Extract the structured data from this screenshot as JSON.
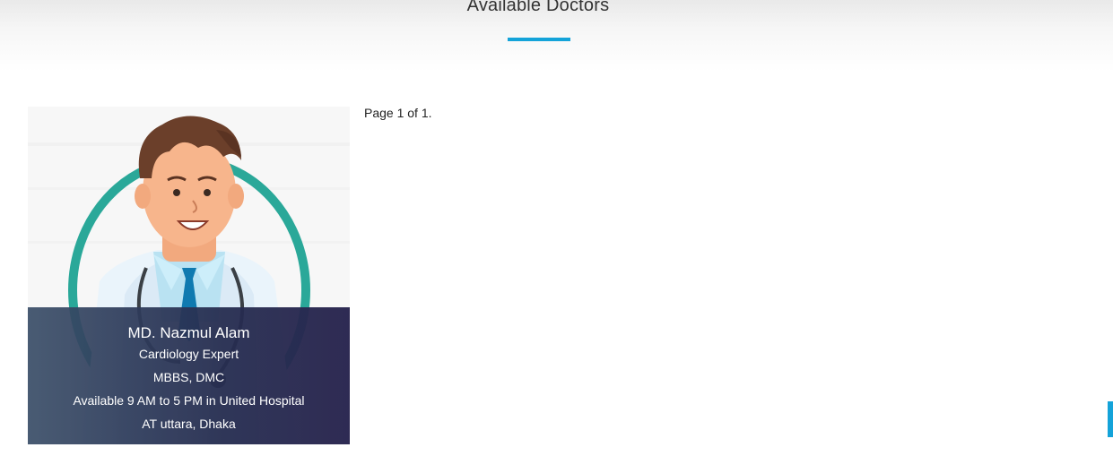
{
  "section": {
    "title": "Available Doctors",
    "accent_color": "#14a3d9"
  },
  "doctor": {
    "name": "MD. Nazmul Alam",
    "specialty": "Cardiology Expert",
    "degrees": "MBBS, DMC",
    "availability": "Available 9 AM to 5 PM in United Hospital",
    "location": "AT uttara, Dhaka",
    "photo_icon": "doctor-illustration-icon"
  },
  "pagination": {
    "text": "Page 1 of 1."
  }
}
